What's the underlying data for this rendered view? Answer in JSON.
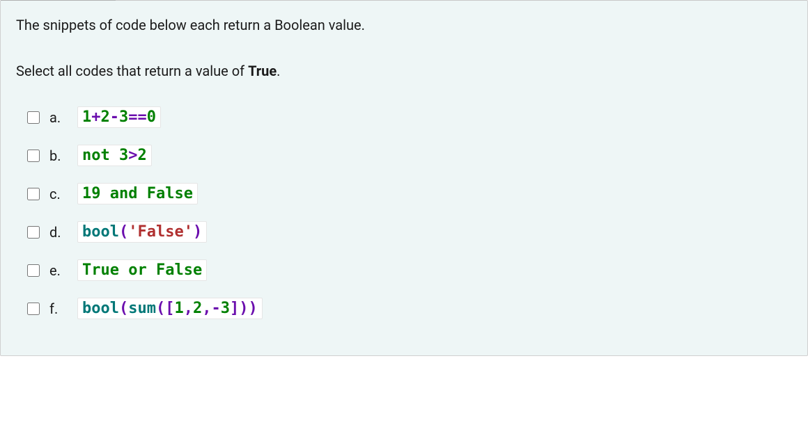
{
  "question": {
    "prompt": "The snippets of code below each return a Boolean value.",
    "instruction_prefix": "Select all codes that return a value of ",
    "instruction_bold": "True",
    "instruction_suffix": ".",
    "options": [
      {
        "letter": "a.",
        "tokens": [
          {
            "text": "1",
            "cls": "c-green"
          },
          {
            "text": "+",
            "cls": "c-purple"
          },
          {
            "text": "2",
            "cls": "c-green"
          },
          {
            "text": "-",
            "cls": "c-purple"
          },
          {
            "text": "3",
            "cls": "c-green"
          },
          {
            "text": "==",
            "cls": "c-purple"
          },
          {
            "text": "0",
            "cls": "c-green"
          }
        ]
      },
      {
        "letter": "b.",
        "tokens": [
          {
            "text": "not ",
            "cls": "c-green"
          },
          {
            "text": "3",
            "cls": "c-green"
          },
          {
            "text": ">",
            "cls": "c-purple"
          },
          {
            "text": "2",
            "cls": "c-green"
          }
        ]
      },
      {
        "letter": "c.",
        "tokens": [
          {
            "text": "19",
            "cls": "c-green"
          },
          {
            "text": " and ",
            "cls": "c-green"
          },
          {
            "text": "False",
            "cls": "c-green"
          }
        ]
      },
      {
        "letter": "d.",
        "tokens": [
          {
            "text": "bool",
            "cls": "c-teal"
          },
          {
            "text": "(",
            "cls": "c-purple"
          },
          {
            "text": "'False'",
            "cls": "c-red"
          },
          {
            "text": ")",
            "cls": "c-purple"
          }
        ]
      },
      {
        "letter": "e.",
        "tokens": [
          {
            "text": "True",
            "cls": "c-green"
          },
          {
            "text": " or ",
            "cls": "c-green"
          },
          {
            "text": "False",
            "cls": "c-green"
          }
        ]
      },
      {
        "letter": "f.",
        "tokens": [
          {
            "text": "bool",
            "cls": "c-teal"
          },
          {
            "text": "(",
            "cls": "c-purple"
          },
          {
            "text": "sum",
            "cls": "c-teal"
          },
          {
            "text": "([",
            "cls": "c-purple"
          },
          {
            "text": "1",
            "cls": "c-green"
          },
          {
            "text": ",",
            "cls": "c-purple"
          },
          {
            "text": "2",
            "cls": "c-green"
          },
          {
            "text": ",",
            "cls": "c-purple"
          },
          {
            "text": "-",
            "cls": "c-purple"
          },
          {
            "text": "3",
            "cls": "c-green"
          },
          {
            "text": "]))",
            "cls": "c-purple"
          }
        ]
      }
    ]
  }
}
